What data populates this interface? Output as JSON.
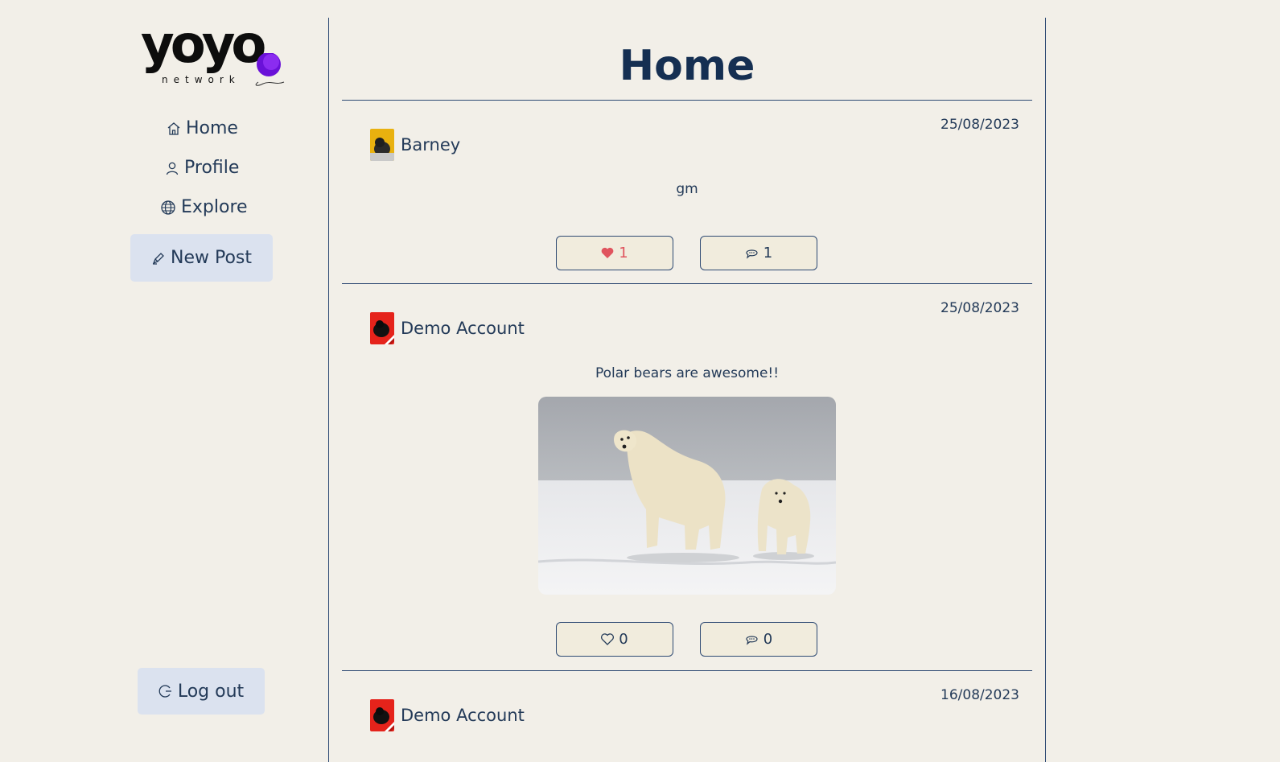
{
  "brand": {
    "logo_text": "yoyo",
    "logo_subtext": "network"
  },
  "nav": {
    "items": [
      {
        "label": "Home",
        "icon": "home-icon"
      },
      {
        "label": "Profile",
        "icon": "user-icon"
      },
      {
        "label": "Explore",
        "icon": "globe-icon"
      }
    ],
    "new_post_label": "New Post",
    "logout_label": "Log out"
  },
  "page": {
    "title": "Home"
  },
  "posts": [
    {
      "author": "Barney",
      "date": "25/08/2023",
      "text": "gm",
      "likes": "1",
      "comments": "1",
      "liked": true,
      "avatar_color": "#e9b10f"
    },
    {
      "author": "Demo Account",
      "date": "25/08/2023",
      "text": "Polar bears are awesome!!",
      "has_image": true,
      "likes": "0",
      "comments": "0",
      "liked": false,
      "avatar_color": "#e5231b"
    },
    {
      "author": "Demo Account",
      "date": "16/08/2023",
      "avatar_color": "#e5231b"
    }
  ],
  "colors": {
    "accent": "#152f52",
    "like": "#e0545e",
    "button_bg": "#dbe2ef"
  }
}
